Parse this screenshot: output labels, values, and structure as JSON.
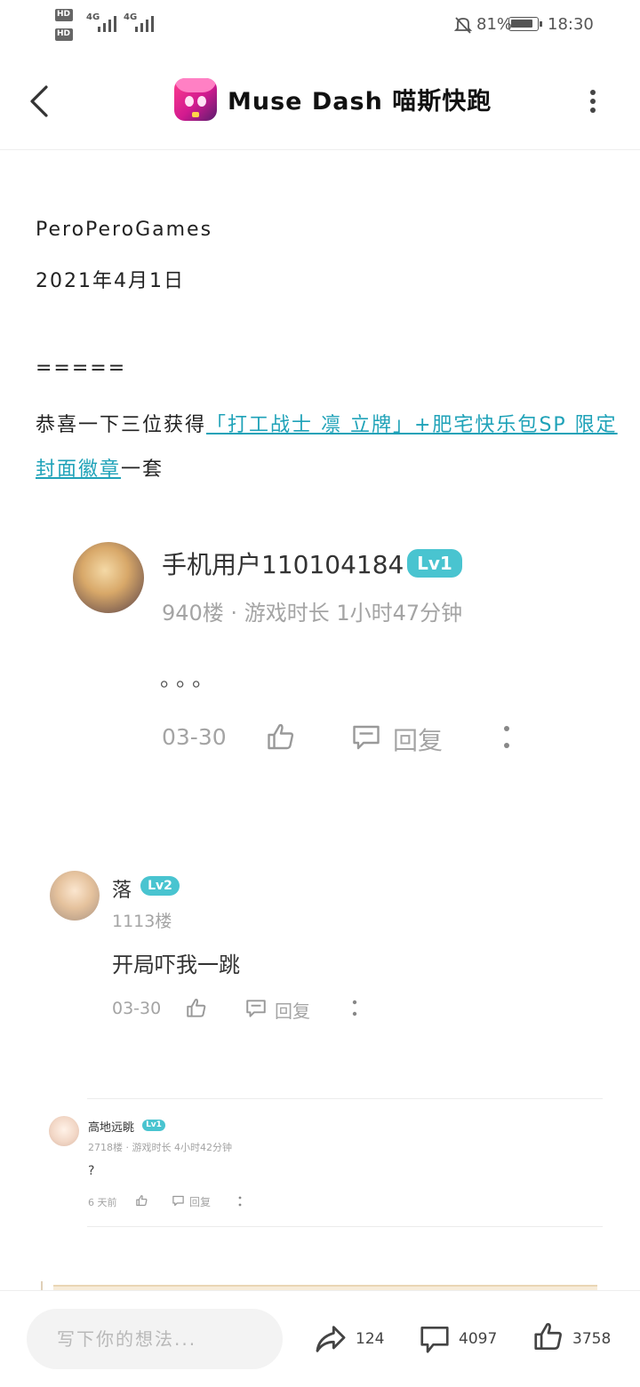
{
  "status_bar": {
    "sim1": "HD",
    "sim2": "HD",
    "net1": "4G",
    "net2": "4G",
    "battery": "81%",
    "time": "18:30"
  },
  "header": {
    "title": "Muse Dash 喵斯快跑"
  },
  "article": {
    "author": "PeroPeroGames",
    "date": "2021年4月1日",
    "separator": "=====",
    "congrats_prefix": "恭喜一下三位获得",
    "link_text_1": "「打工战士 凛 立牌」+肥宅快乐包",
    "link_text_2": "SP 限定封面徽章",
    "congrats_suffix": "一套"
  },
  "comment1": {
    "username": "手机用户110104184",
    "level": "Lv1",
    "meta": "940楼 · 游戏时长 1小时47分钟",
    "content": "。。。",
    "date": "03-30",
    "reply": "回复"
  },
  "comment2": {
    "username": "落",
    "level": "Lv2",
    "floor": "1113楼",
    "content": "开局吓我一跳",
    "date": "03-30",
    "reply": "回复"
  },
  "comment3": {
    "username": "高地远眺",
    "level": "Lv1",
    "meta": "2718楼 · 游戏时长 4小时42分钟",
    "content": "?",
    "date": "6 天前",
    "reply": "回复"
  },
  "bottom_bar": {
    "input_placeholder": "写下你的想法...",
    "share_count": "124",
    "comment_count": "4097",
    "like_count": "3758"
  }
}
